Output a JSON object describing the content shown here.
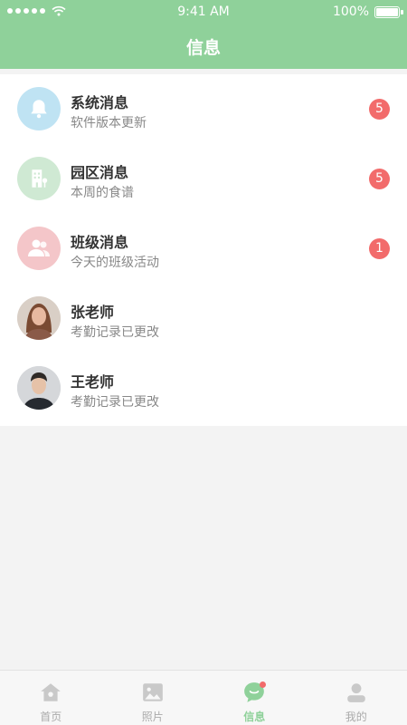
{
  "status_bar": {
    "time": "9:41 AM",
    "battery": "100%",
    "battery_level": 1.0
  },
  "header": {
    "title": "信息"
  },
  "messages": [
    {
      "title": "系统消息",
      "subtitle": "软件版本更新",
      "badge": "5",
      "icon": "bell-icon",
      "icon_bg": "#bfe3f3"
    },
    {
      "title": "园区消息",
      "subtitle": "本周的食谱",
      "badge": "5",
      "icon": "building-icon",
      "icon_bg": "#cfe9d3"
    },
    {
      "title": "班级消息",
      "subtitle": "今天的班级活动",
      "badge": "1",
      "icon": "users-icon",
      "icon_bg": "#f4c6c9"
    },
    {
      "title": "张老师",
      "subtitle": "考勤记录已更改",
      "icon": "avatar-female"
    },
    {
      "title": "王老师",
      "subtitle": "考勤记录已更改",
      "icon": "avatar-male"
    }
  ],
  "tabbar": [
    {
      "label": "首页",
      "icon": "home-icon"
    },
    {
      "label": "照片",
      "icon": "photo-icon"
    },
    {
      "label": "信息",
      "icon": "message-icon",
      "active": true
    },
    {
      "label": "我的",
      "icon": "profile-icon"
    }
  ],
  "colors": {
    "primary": "#8fd19a",
    "badge": "#f26b6b",
    "background": "#f3f3f3"
  }
}
